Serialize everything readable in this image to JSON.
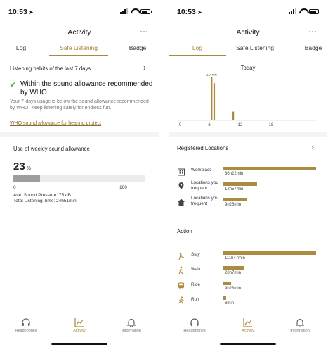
{
  "status_bar": {
    "time": "10:53",
    "arrow": "➤"
  },
  "header": {
    "title": "Activity",
    "more_icon": "⋯"
  },
  "tabs": [
    {
      "label": "Log"
    },
    {
      "label": "Safe Listening"
    },
    {
      "label": "Badge"
    }
  ],
  "left": {
    "habits_title": "Listening habits of the last 7 days",
    "who_title": "Within the sound allowance recommended by WHO.",
    "description": "Your 7-days usage is below the sound allowance recommended by WHO. Keep listening safely for endless fun.",
    "link": "WHO sound allowance for hearing protect",
    "weekly_title": "Use of weekly sound allowance",
    "percent_value": "23",
    "percent_unit": "%",
    "progress_fraction": 0.2,
    "tick_min": "0",
    "tick_max": "100",
    "ave_pressure": "Ave. Sound Pressure: 75 dB",
    "total_time": "Total Listening Time: 24h51min"
  },
  "right": {
    "today_title": "Today",
    "chart_data": {
      "type": "bar",
      "title": "Today",
      "xlabel": "",
      "ylabel": "",
      "x_ticks": [
        "0",
        "6",
        "12",
        "18"
      ],
      "xlim": [
        0,
        24
      ],
      "ylim": [
        0,
        20
      ],
      "peak_label": "20min",
      "bars": [
        {
          "x": 6.3,
          "value": 20
        },
        {
          "x": 6.8,
          "value": 17
        },
        {
          "x": 10.5,
          "value": 4
        }
      ]
    },
    "locations_title": "Registered Locations",
    "locations": [
      {
        "label": "Workplace",
        "value": "36h22min",
        "fraction": 1.0
      },
      {
        "label": "Locations you frequent",
        "value": "12h57min",
        "fraction": 0.36
      },
      {
        "label": "Locations you frequent",
        "value": "9h26min",
        "fraction": 0.26
      }
    ],
    "action_title": "Action",
    "actions": [
      {
        "label": "Stay",
        "value": "111h47min",
        "fraction": 1.0
      },
      {
        "label": "Walk",
        "value": "28h7min",
        "fraction": 0.23
      },
      {
        "label": "Ride",
        "value": "9h23min",
        "fraction": 0.08
      },
      {
        "label": "Run",
        "value": "6min",
        "fraction": 0.03
      }
    ]
  },
  "nav": [
    {
      "label": "Headphones",
      "icon": "headphones-icon"
    },
    {
      "label": "Activity",
      "icon": "activity-chart-icon"
    },
    {
      "label": "Information",
      "icon": "bell-icon"
    }
  ],
  "colors": {
    "accent": "#a8873f",
    "bar": "#ad8a3f",
    "check": "#4caf50"
  }
}
